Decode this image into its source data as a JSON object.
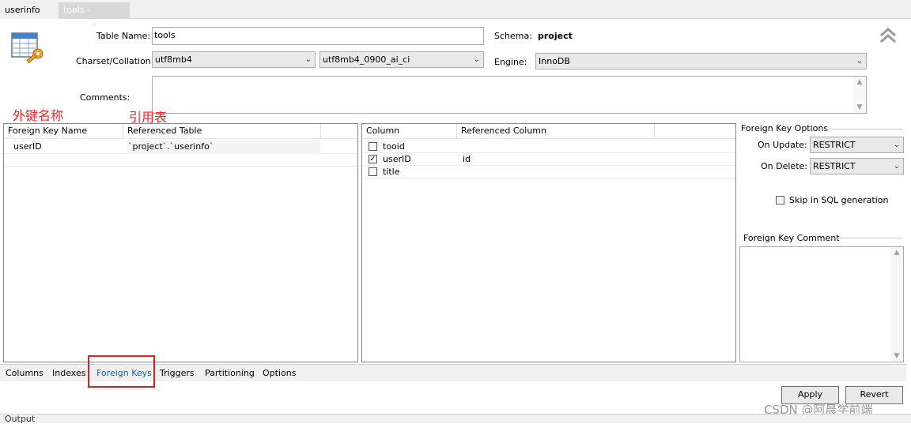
{
  "tabs": {
    "first": "userinfo",
    "active": "tools - Table",
    "close_glyph": "✕"
  },
  "header": {
    "table_name_label": "Table Name:",
    "table_name_value": "tools",
    "schema_label": "Schema:",
    "schema_value": "project",
    "charset_label": "Charset/Collation:",
    "charset_value": "utf8mb4",
    "collation_value": "utf8mb4_0900_ai_ci",
    "engine_label": "Engine:",
    "engine_value": "InnoDB",
    "comments_label": "Comments:",
    "comments_value": ""
  },
  "annotations": {
    "fk_name": "外键名称",
    "ref_table": "引用表"
  },
  "fk_grid": {
    "headers": [
      "Foreign Key Name",
      "Referenced Table"
    ],
    "rows": [
      {
        "name": "userID",
        "ref": "`project`.`userinfo`"
      }
    ]
  },
  "col_grid": {
    "headers": [
      "Column",
      "Referenced Column"
    ],
    "rows": [
      {
        "checked": false,
        "column": "tooid",
        "ref": ""
      },
      {
        "checked": true,
        "column": "userID",
        "ref": "id"
      },
      {
        "checked": false,
        "column": "title",
        "ref": ""
      }
    ]
  },
  "options": {
    "group_title": "Foreign Key Options",
    "on_update_label": "On Update:",
    "on_update_value": "RESTRICT",
    "on_delete_label": "On Delete:",
    "on_delete_value": "RESTRICT",
    "skip_label": "Skip in SQL generation",
    "comment_title": "Foreign Key Comment"
  },
  "bottom_tabs": [
    "Columns",
    "Indexes",
    "Foreign Keys",
    "Triggers",
    "Partitioning",
    "Options"
  ],
  "active_bottom_tab": "Foreign Keys",
  "buttons": {
    "apply": "Apply",
    "revert": "Revert"
  },
  "output_label": "Output",
  "watermark": "CSDN @阿晨学前端",
  "colors": {
    "annotation": "#ff2020",
    "highlight_box": "#e02020",
    "active_tab_text": "#1a5fb4"
  },
  "icons": [
    "table-icon",
    "collapse-icon",
    "dropdown-arrow-icon",
    "checkbox-icon"
  ]
}
